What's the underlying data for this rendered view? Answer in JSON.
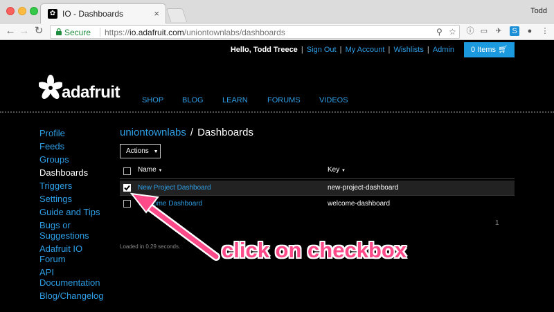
{
  "browser": {
    "tab_title": "IO - Dashboards",
    "profile": "Todd",
    "secure_label": "Secure",
    "url_scheme": "https://",
    "url_host": "io.adafruit.com",
    "url_path": "/uniontownlabs/dashboards"
  },
  "header": {
    "greeting": "Hello, Todd Treece",
    "sign_out": "Sign Out",
    "my_account": "My Account",
    "wishlists": "Wishlists",
    "admin": "Admin",
    "cart": "0 Items",
    "logo_text": "adafruit",
    "nav": [
      "SHOP",
      "BLOG",
      "LEARN",
      "FORUMS",
      "VIDEOS"
    ]
  },
  "sidebar": {
    "items": [
      "Profile",
      "Feeds",
      "Groups",
      "Dashboards",
      "Triggers",
      "Settings",
      "Guide and Tips",
      "Bugs or",
      "Suggestions",
      "Adafruit IO",
      "Forum",
      "API",
      "Documentation",
      "Blog/Changelog"
    ],
    "active_index": 3
  },
  "main": {
    "breadcrumb_org": "uniontownlabs",
    "breadcrumb_sep": "/",
    "breadcrumb_current": "Dashboards",
    "actions_label": "Actions",
    "col_name": "Name",
    "col_key": "Key",
    "rows": [
      {
        "name": "New Project Dashboard",
        "key": "new-project-dashboard",
        "checked": true
      },
      {
        "name": "Welcome Dashboard",
        "key": "welcome-dashboard",
        "checked": false
      }
    ],
    "pager": "1",
    "loaded": "Loaded in 0.29 seconds."
  },
  "annotation": {
    "text": "click on checkbox",
    "color": "#ff4a8a"
  },
  "colors": {
    "link": "#2e9fe6",
    "cart": "#1c9ae0",
    "secure": "#1e8e3e"
  }
}
